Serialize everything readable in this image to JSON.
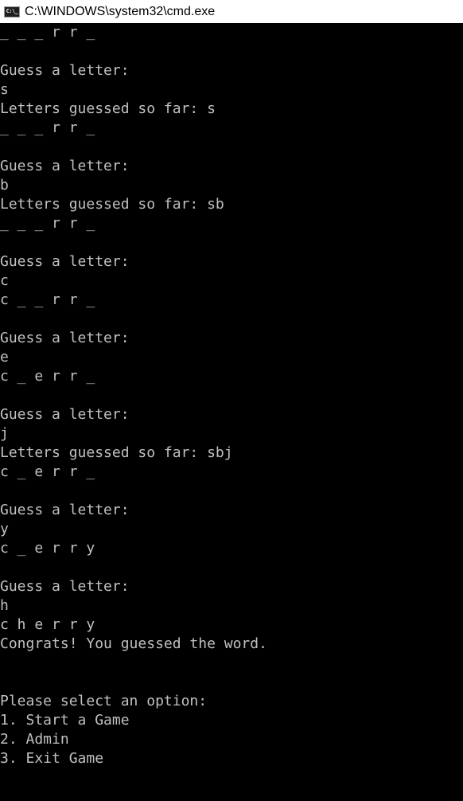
{
  "window": {
    "title": "C:\\WINDOWS\\system32\\cmd.exe",
    "icon": "cmd-icon",
    "icon_text": "C:\\_"
  },
  "console": {
    "text_color": "#c0c0c0",
    "background": "#000000",
    "lines": [
      "_ _ _ r r _",
      "",
      "Guess a letter:",
      "s",
      "Letters guessed so far: s",
      "_ _ _ r r _",
      "",
      "Guess a letter:",
      "b",
      "Letters guessed so far: sb",
      "_ _ _ r r _",
      "",
      "Guess a letter:",
      "c",
      "c _ _ r r _",
      "",
      "Guess a letter:",
      "e",
      "c _ e r r _",
      "",
      "Guess a letter:",
      "j",
      "Letters guessed so far: sbj",
      "c _ e r r _",
      "",
      "Guess a letter:",
      "y",
      "c _ e r r y",
      "",
      "Guess a letter:",
      "h",
      "c h e r r y",
      "Congrats! You guessed the word.",
      "",
      "",
      "Please select an option:",
      "1. Start a Game",
      "2. Admin",
      "3. Exit Game"
    ]
  }
}
